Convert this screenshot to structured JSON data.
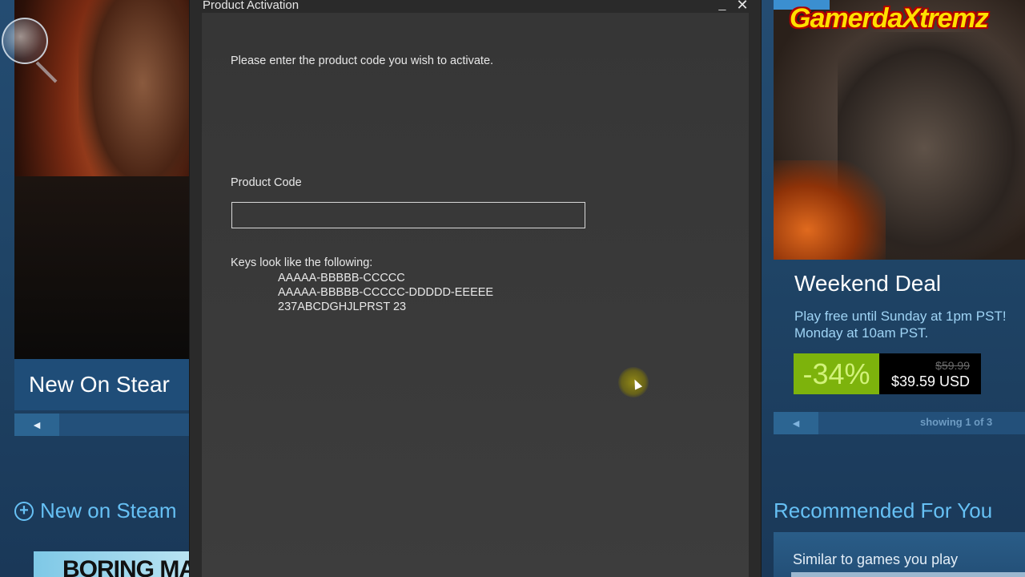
{
  "background": {
    "left_banner": "New On Stear",
    "left_section_title": "New on Steam",
    "left_thumb_text": "BORING MA",
    "watermark": "GamerdaXtremz",
    "deal": {
      "title": "Weekend Deal",
      "desc_line1": "Play free until Sunday at 1pm PST!",
      "desc_line2": "Monday at 10am PST.",
      "discount": "-34%",
      "original_price": "$59.99",
      "final_price": "$39.59 USD"
    },
    "carousel_counter": "showing 1 of 3",
    "right_section_title": "Recommended For You",
    "recommended_sub": "Similar to games you play",
    "nav_arrow": "◄"
  },
  "dialog": {
    "title": "Product Activation",
    "minimize_label": "_",
    "close_label": "✕",
    "prompt": "Please enter the product code you wish to activate.",
    "code_label": "Product Code",
    "code_value": "",
    "keys_title": "Keys look like the following:",
    "key_examples": [
      "AAAAA-BBBBB-CCCCC",
      "AAAAA-BBBBB-CCCCC-DDDDD-EEEEE",
      "237ABCDGHJLPRST 23"
    ]
  },
  "colors": {
    "steam_blue": "#66c0f4",
    "discount_green": "#7db30c",
    "dialog_bg": "#393939"
  }
}
